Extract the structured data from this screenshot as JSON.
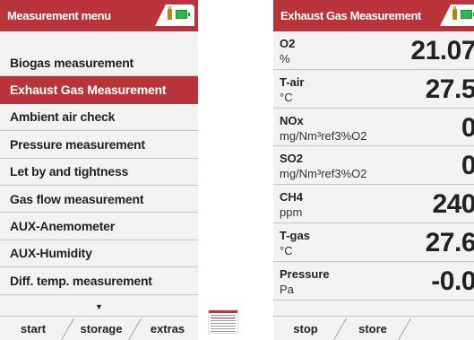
{
  "left_screen": {
    "title": "Measurement menu",
    "menu_items": [
      "Biogas measurement",
      "Exhaust Gas Measurement",
      "Ambient air check",
      "Pressure measurement",
      "Let by and tightness",
      "Gas flow measurement",
      "AUX-Anemometer",
      "AUX-Humidity",
      "Diff. temp. measurement"
    ],
    "selected_index": 1,
    "scroll_indicator": "▼",
    "softkeys": {
      "start": "start",
      "storage": "storage",
      "extras": "extras"
    }
  },
  "right_screen": {
    "title": "Exhaust Gas Measurement",
    "rows": [
      {
        "name": "O2",
        "unit": "%",
        "value": "21.07"
      },
      {
        "name": "T-air",
        "unit": "°C",
        "value": "27.5"
      },
      {
        "name": "NOx",
        "unit": "mg/Nm³ref3%O2",
        "value": "0"
      },
      {
        "name": "SO2",
        "unit": "mg/Nm³ref3%O2",
        "value": "0"
      },
      {
        "name": "CH4",
        "unit": "ppm",
        "value": "240"
      },
      {
        "name": "T-gas",
        "unit": "°C",
        "value": "27.6"
      },
      {
        "name": "Pressure",
        "unit": "Pa",
        "value": "-0.0"
      }
    ],
    "softkeys": {
      "stop": "stop",
      "store": "store"
    }
  },
  "colors": {
    "accent": "#b8343a",
    "battery": "#2db84a",
    "plug": "#b8860b",
    "background": "#f2f2f2"
  },
  "icons": [
    "plug-icon",
    "battery-icon",
    "scroll-down-icon"
  ]
}
